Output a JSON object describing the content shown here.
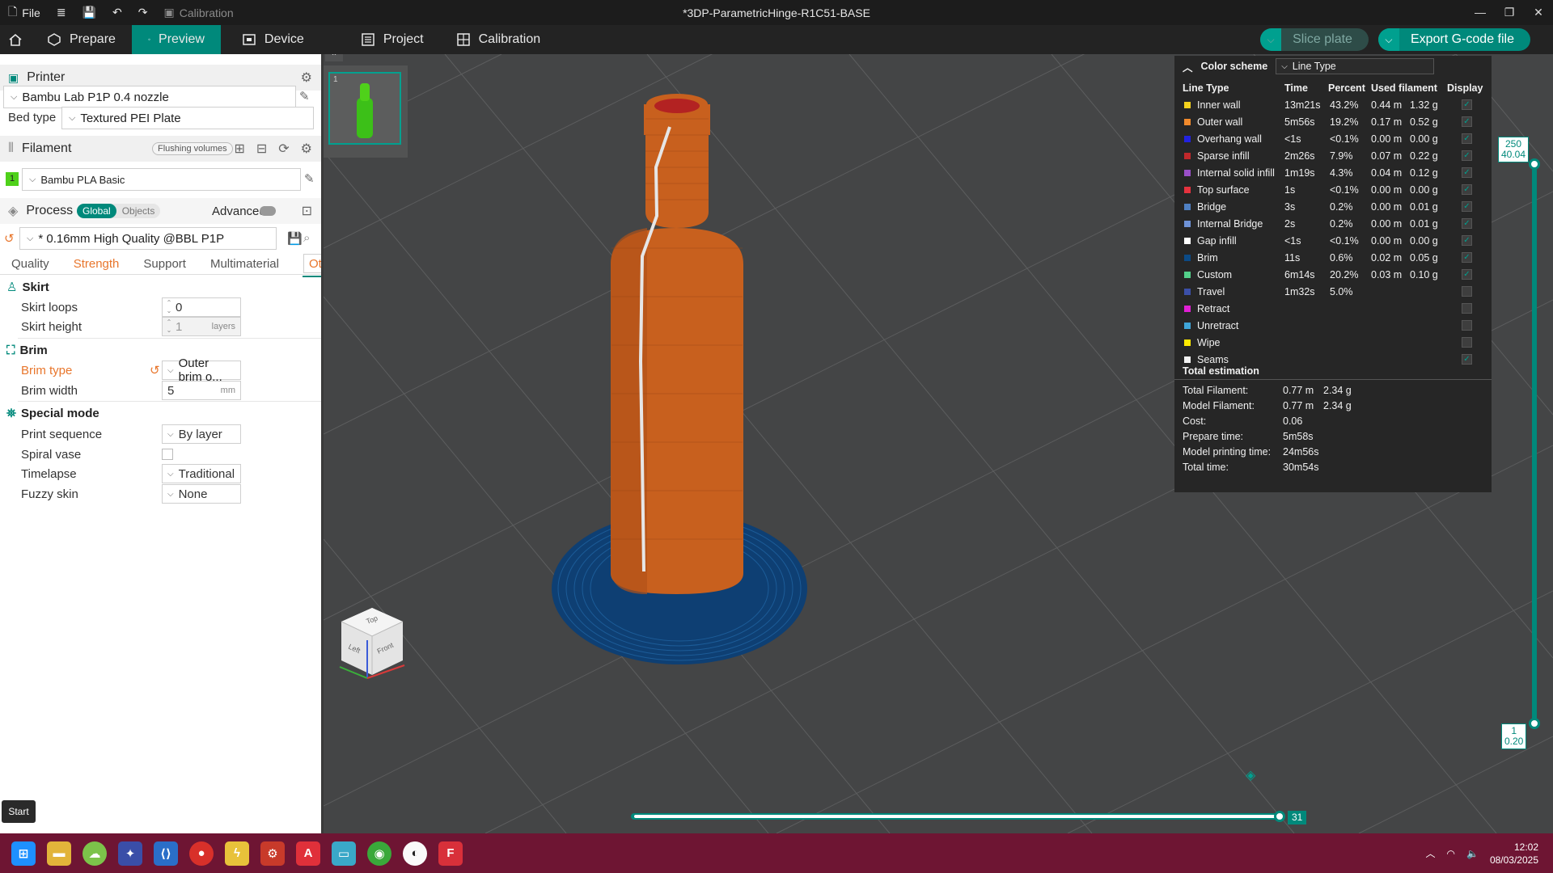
{
  "window": {
    "file_label": "File",
    "calibration_label": "Calibration",
    "title": "*3DP-ParametricHinge-R1C51-BASE"
  },
  "tabs": [
    {
      "label": "Prepare"
    },
    {
      "label": "Preview"
    },
    {
      "label": "Device"
    },
    {
      "label": "Project"
    },
    {
      "label": "Calibration"
    }
  ],
  "actions": {
    "slice_label": "Slice plate",
    "export_label": "Export G-code file"
  },
  "printer": {
    "section_label": "Printer",
    "name": "Bambu Lab P1P 0.4 nozzle",
    "bed_type_label": "Bed type",
    "bed_type_value": "Textured PEI Plate"
  },
  "filament": {
    "section_label": "Filament",
    "flushing_label": "Flushing volumes",
    "slot_number": "1",
    "slot_color": "#4fd11a",
    "name": "Bambu PLA Basic"
  },
  "process": {
    "section_label": "Process",
    "global_label": "Global",
    "objects_label": "Objects",
    "advanced_label": "Advanced",
    "preset": "* 0.16mm High Quality @BBL P1P",
    "subtabs": [
      {
        "label": "Quality"
      },
      {
        "label": "Strength"
      },
      {
        "label": "Support"
      },
      {
        "label": "Multimaterial"
      },
      {
        "label": "Others"
      }
    ]
  },
  "settings": {
    "skirt_title": "Skirt",
    "skirt_loops_label": "Skirt loops",
    "skirt_loops_value": "0",
    "skirt_height_label": "Skirt height",
    "skirt_height_value": "1",
    "skirt_height_unit": "layers",
    "brim_title": "Brim",
    "brim_type_label": "Brim type",
    "brim_type_value": "Outer brim o...",
    "brim_width_label": "Brim width",
    "brim_width_value": "5",
    "brim_width_unit": "mm",
    "special_title": "Special mode",
    "print_seq_label": "Print sequence",
    "print_seq_value": "By layer",
    "spiral_label": "Spiral vase",
    "timelapse_label": "Timelapse",
    "timelapse_value": "Traditional",
    "fuzzy_label": "Fuzzy skin",
    "fuzzy_value": "None"
  },
  "thumbnail": {
    "plate_number": "1"
  },
  "legend": {
    "color_scheme_label": "Color scheme",
    "scheme_value": "Line Type",
    "headers": {
      "type": "Line Type",
      "time": "Time",
      "percent": "Percent",
      "used": "Used filament",
      "display": "Display"
    },
    "rows": [
      {
        "name": "Inner wall",
        "color": "#f4d21d",
        "time": "13m21s",
        "percent": "43.2%",
        "m": "0.44 m",
        "g": "1.32 g",
        "checked": true
      },
      {
        "name": "Outer wall",
        "color": "#f28a2c",
        "time": "5m56s",
        "percent": "19.2%",
        "m": "0.17 m",
        "g": "0.52 g",
        "checked": true
      },
      {
        "name": "Overhang wall",
        "color": "#2222e0",
        "time": "<1s",
        "percent": "<0.1%",
        "m": "0.00 m",
        "g": "0.00 g",
        "checked": true
      },
      {
        "name": "Sparse infill",
        "color": "#c0282b",
        "time": "2m26s",
        "percent": "7.9%",
        "m": "0.07 m",
        "g": "0.22 g",
        "checked": true
      },
      {
        "name": "Internal solid infill",
        "color": "#9a4fc8",
        "time": "1m19s",
        "percent": "4.3%",
        "m": "0.04 m",
        "g": "0.12 g",
        "checked": true
      },
      {
        "name": "Top surface",
        "color": "#e5323e",
        "time": "1s",
        "percent": "<0.1%",
        "m": "0.00 m",
        "g": "0.00 g",
        "checked": true
      },
      {
        "name": "Bridge",
        "color": "#4f80c3",
        "time": "3s",
        "percent": "0.2%",
        "m": "0.00 m",
        "g": "0.01 g",
        "checked": true
      },
      {
        "name": "Internal Bridge",
        "color": "#6f93d8",
        "time": "2s",
        "percent": "0.2%",
        "m": "0.00 m",
        "g": "0.01 g",
        "checked": true
      },
      {
        "name": "Gap infill",
        "color": "#ffffff",
        "time": "<1s",
        "percent": "<0.1%",
        "m": "0.00 m",
        "g": "0.00 g",
        "checked": true
      },
      {
        "name": "Brim",
        "color": "#0b4a86",
        "time": "11s",
        "percent": "0.6%",
        "m": "0.02 m",
        "g": "0.05 g",
        "checked": true
      },
      {
        "name": "Custom",
        "color": "#53d08a",
        "time": "6m14s",
        "percent": "20.2%",
        "m": "0.03 m",
        "g": "0.10 g",
        "checked": true
      },
      {
        "name": "Travel",
        "color": "#3b4fa8",
        "time": "1m32s",
        "percent": "5.0%",
        "m": "",
        "g": "",
        "checked": false
      },
      {
        "name": "Retract",
        "color": "#e01fd4",
        "time": "",
        "percent": "",
        "m": "",
        "g": "",
        "checked": false
      },
      {
        "name": "Unretract",
        "color": "#3fa5d8",
        "time": "",
        "percent": "",
        "m": "",
        "g": "",
        "checked": false
      },
      {
        "name": "Wipe",
        "color": "#ffea00",
        "time": "",
        "percent": "",
        "m": "",
        "g": "",
        "checked": false
      },
      {
        "name": "Seams",
        "color": "#f2f2f2",
        "time": "",
        "percent": "",
        "m": "",
        "g": "",
        "checked": true
      }
    ],
    "total_title": "Total estimation",
    "totals": [
      {
        "k": "Total Filament:",
        "v1": "0.77 m",
        "v2": "2.34 g"
      },
      {
        "k": "Model Filament:",
        "v1": "0.77 m",
        "v2": "2.34 g"
      },
      {
        "k": "Cost:",
        "v1": "0.06",
        "v2": ""
      },
      {
        "k": "Prepare time:",
        "v1": "5m58s",
        "v2": ""
      },
      {
        "k": "Model printing time:",
        "v1": "24m56s",
        "v2": ""
      },
      {
        "k": "Total time:",
        "v1": "30m54s",
        "v2": ""
      }
    ]
  },
  "vslider": {
    "top_layer": "250",
    "top_height": "40.04",
    "bottom_layer": "1",
    "bottom_height": "0.20"
  },
  "hslider": {
    "value": "31"
  },
  "navcube": {
    "top": "Top",
    "left": "Left",
    "front": "Front"
  },
  "start_tooltip": "Start",
  "clock": {
    "time": "12:02",
    "date": "08/03/2025"
  }
}
